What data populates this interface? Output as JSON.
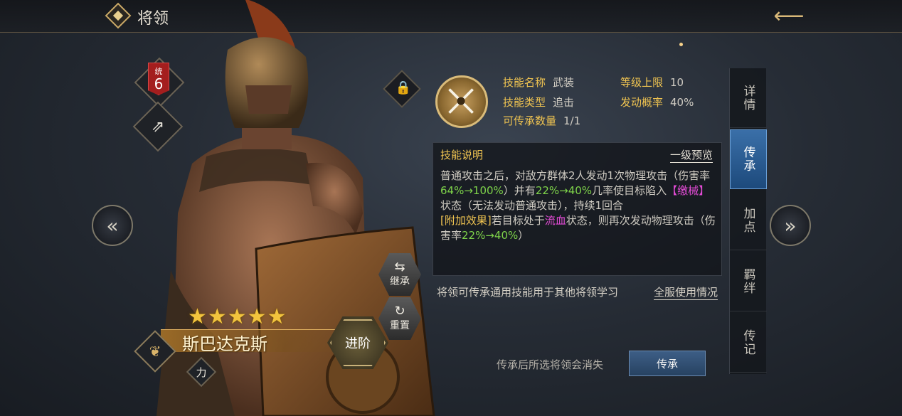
{
  "header": {
    "title": "将领",
    "back_icon": "arrow-left-icon"
  },
  "hero": {
    "rank_label": "统",
    "rank_value": "6",
    "stars": 5,
    "stars_text": "★★★★★",
    "name": "斯巴达克斯",
    "attribute": "力",
    "advance_label": "进阶",
    "inherit_small_label": "继承",
    "reset_label": "重置"
  },
  "skill": {
    "name_label": "技能名称",
    "name_value": "武装",
    "type_label": "技能类型",
    "type_value": "追击",
    "count_label": "可传承数量",
    "count_value": "1/1",
    "level_cap_label": "等级上限",
    "level_cap_value": "10",
    "trigger_label": "发动概率",
    "trigger_value": "40%",
    "desc_title": "技能说明",
    "preview_link": "一级预览",
    "desc_part1": "普通攻击之后，对敌方群体2人发动1次物理攻击（伤害率",
    "desc_dmg": "64%→100%",
    "desc_part2": "）并有",
    "desc_rate": "22%→40%",
    "desc_part3": "几率使目标陷入",
    "desc_status": "【缴械】",
    "desc_part4": "状态（无法发动普通攻击），持续1回合",
    "extra_label": "[附加效果]",
    "extra_part1": "若目标处于",
    "extra_status": "流血",
    "extra_part2": "状态，则再次发动物理攻击（伤害率",
    "extra_dmg": "22%→40%",
    "extra_part3": "）"
  },
  "info_text": "将领可传承通用技能用于其他将领学习",
  "server_link": "全服使用情况",
  "bottom_hint": "传承后所选将领会消失",
  "inherit_button": "传承",
  "tabs": [
    "详情",
    "传承",
    "加点",
    "羁绊",
    "传记"
  ],
  "active_tab": "传承",
  "colors": {
    "accent_gold": "#f0c451",
    "active_tab_blue": "#2a5b92",
    "highlight_green": "#7ed34a",
    "status_pink": "#e34bd6"
  }
}
